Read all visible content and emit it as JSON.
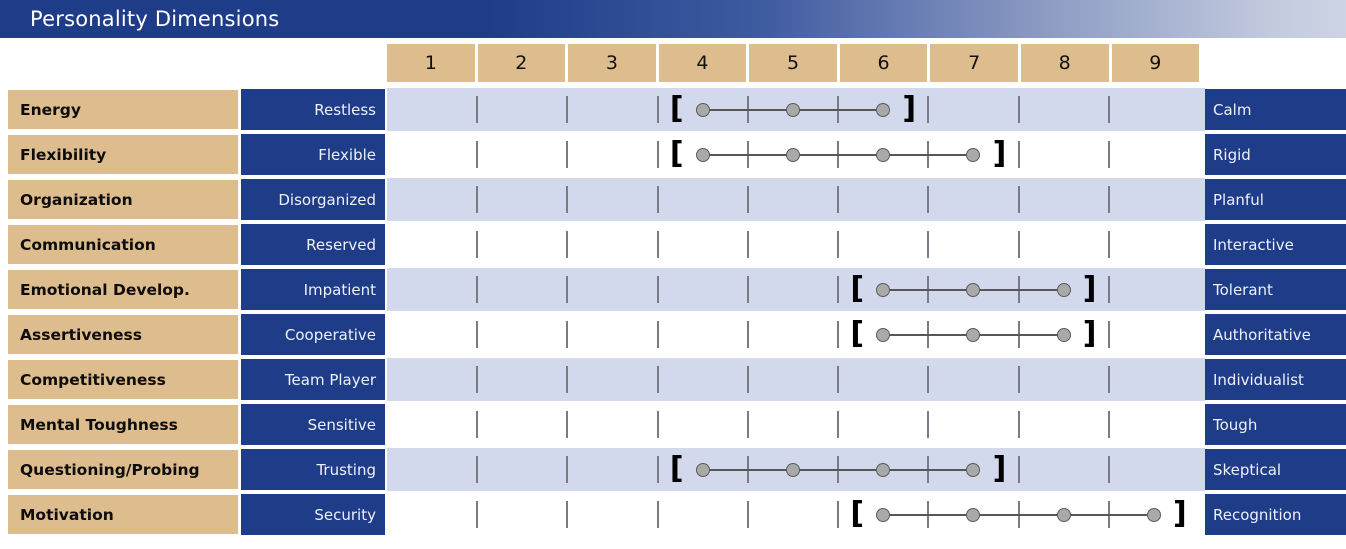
{
  "header": {
    "title": "Personality Dimensions"
  },
  "scale": {
    "columns": [
      "1",
      "2",
      "3",
      "4",
      "5",
      "6",
      "7",
      "8",
      "9"
    ]
  },
  "colors": {
    "title_start": "#1f3c88",
    "title_end": "#cdd4e4",
    "trait_tan": "#ddbc8d",
    "pole_blue": "#1f3c88",
    "row_alt": "#d3d9ec",
    "dot_fill": "#a9a9a9",
    "dot_stroke": "#5a5a5a",
    "tick": "#7b7b83"
  },
  "chart_data": {
    "type": "range-plot",
    "title": "Personality Dimensions",
    "xlabel": "",
    "ylabel": "",
    "xlim": [
      1,
      9
    ],
    "x_ticks": [
      1,
      2,
      3,
      4,
      5,
      6,
      7,
      8,
      9
    ],
    "grid": true,
    "legend": "none",
    "rows": [
      {
        "trait": "Energy",
        "low_pole": "Restless",
        "high_pole": "Calm",
        "shaded": true,
        "range": [
          4,
          6
        ],
        "points": [
          4,
          5,
          6
        ]
      },
      {
        "trait": "Flexibility",
        "low_pole": "Flexible",
        "high_pole": "Rigid",
        "shaded": false,
        "range": [
          4,
          7
        ],
        "points": [
          4,
          5,
          6,
          7
        ]
      },
      {
        "trait": "Organization",
        "low_pole": "Disorganized",
        "high_pole": "Planful",
        "shaded": true,
        "range": null,
        "points": []
      },
      {
        "trait": "Communication",
        "low_pole": "Reserved",
        "high_pole": "Interactive",
        "shaded": false,
        "range": null,
        "points": []
      },
      {
        "trait": "Emotional Develop.",
        "low_pole": "Impatient",
        "high_pole": "Tolerant",
        "shaded": true,
        "range": [
          6,
          8
        ],
        "points": [
          6,
          7,
          8
        ]
      },
      {
        "trait": "Assertiveness",
        "low_pole": "Cooperative",
        "high_pole": "Authoritative",
        "shaded": false,
        "range": [
          6,
          8
        ],
        "points": [
          6,
          7,
          8
        ]
      },
      {
        "trait": "Competitiveness",
        "low_pole": "Team Player",
        "high_pole": "Individualist",
        "shaded": true,
        "range": null,
        "points": []
      },
      {
        "trait": "Mental Toughness",
        "low_pole": "Sensitive",
        "high_pole": "Tough",
        "shaded": false,
        "range": null,
        "points": []
      },
      {
        "trait": "Questioning/Probing",
        "low_pole": "Trusting",
        "high_pole": "Skeptical",
        "shaded": true,
        "range": [
          4,
          7
        ],
        "points": [
          4,
          5,
          6,
          7
        ]
      },
      {
        "trait": "Motivation",
        "low_pole": "Security",
        "high_pole": "Recognition",
        "shaded": false,
        "range": [
          6,
          9
        ],
        "points": [
          6,
          7,
          8,
          9
        ]
      }
    ]
  }
}
